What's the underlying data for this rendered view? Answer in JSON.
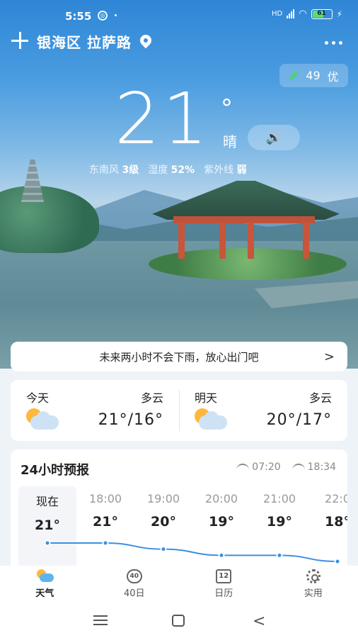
{
  "status": {
    "time": "5:55",
    "network": "HD",
    "battery": "61",
    "battery_level": 0.61
  },
  "header": {
    "location": "银海区 拉萨路"
  },
  "aqi": {
    "value": "49",
    "label": "优"
  },
  "current": {
    "temperature": "21",
    "degree": "°",
    "condition": "晴",
    "speaker": "🔊",
    "wind_label": "东南风",
    "wind_value": "3级",
    "humidity_label": "湿度",
    "humidity_value": "52%",
    "uv_label": "紫外线",
    "uv_value": "弱"
  },
  "rain_notice": {
    "text": "未来两小时不会下雨，放心出门吧",
    "arrow": ">"
  },
  "days": [
    {
      "name": "今天",
      "condition": "多云",
      "range": "21°/16°"
    },
    {
      "name": "明天",
      "condition": "多云",
      "range": "20°/17°"
    }
  ],
  "hourly": {
    "title": "24小时预报",
    "sunrise": "07:20",
    "sunset": "18:34",
    "items": [
      {
        "time": "现在",
        "temp": "21°",
        "value": 21
      },
      {
        "time": "18:00",
        "temp": "21°",
        "value": 21
      },
      {
        "time": "19:00",
        "temp": "20°",
        "value": 20
      },
      {
        "time": "20:00",
        "temp": "19°",
        "value": 19
      },
      {
        "time": "21:00",
        "temp": "19°",
        "value": 19
      },
      {
        "time": "22:0",
        "temp": "18°",
        "value": 18
      }
    ]
  },
  "nav": [
    {
      "label": "天气",
      "icon": "weather-icon"
    },
    {
      "label": "40日",
      "icon": "forty-day-icon",
      "badge": "40"
    },
    {
      "label": "日历",
      "icon": "calendar-icon",
      "badge": "12"
    },
    {
      "label": "实用",
      "icon": "settings-gear-icon"
    }
  ],
  "colors": {
    "accent": "#2f86d6",
    "line": "#3b8fe0",
    "aqi_leaf": "#4fd07a"
  }
}
